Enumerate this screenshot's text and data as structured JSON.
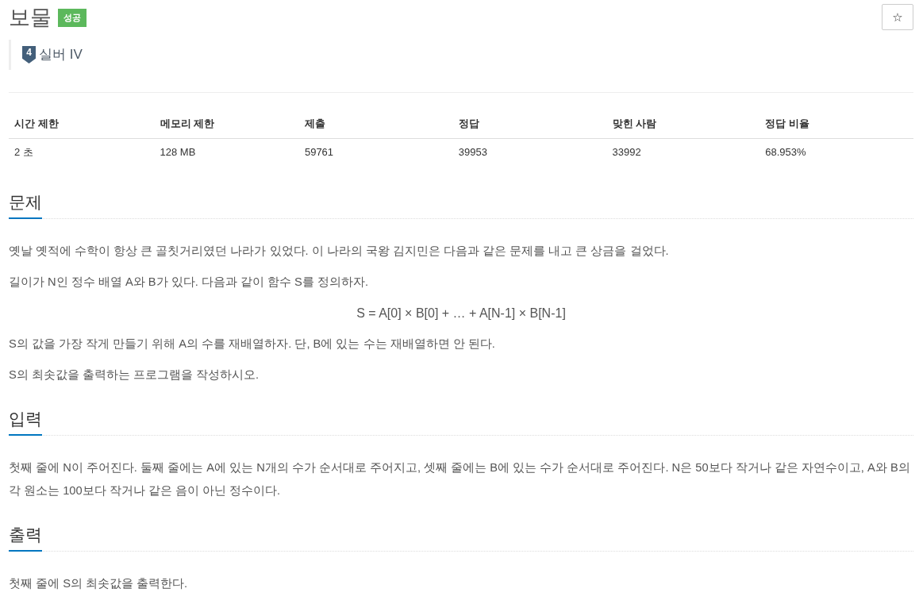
{
  "header": {
    "title": "보물",
    "status_badge": "성공",
    "tier": {
      "icon_number": "4",
      "name": "실버 IV"
    },
    "star_button": "☆"
  },
  "stats_table": {
    "columns": [
      "시간 제한",
      "메모리 제한",
      "제출",
      "정답",
      "맞힌 사람",
      "정답 비율"
    ],
    "rows": [
      [
        "2 초",
        "128 MB",
        "59761",
        "39953",
        "33992",
        "68.953%"
      ]
    ]
  },
  "sections": [
    {
      "heading": "문제",
      "blocks": [
        {
          "kind": "paragraph",
          "text": "옛날 옛적에 수학이 항상 큰 골칫거리였던 나라가 있었다. 이 나라의 국왕 김지민은 다음과 같은 문제를 내고 큰 상금을 걸었다."
        },
        {
          "kind": "paragraph",
          "text": "길이가 N인 정수 배열 A와 B가 있다. 다음과 같이 함수 S를 정의하자."
        },
        {
          "kind": "formula",
          "text": "S = A[0] × B[0] + … + A[N-1] × B[N-1]"
        },
        {
          "kind": "paragraph",
          "text": "S의 값을 가장 작게 만들기 위해 A의 수를 재배열하자. 단, B에 있는 수는 재배열하면 안 된다."
        },
        {
          "kind": "paragraph",
          "text": "S의 최솟값을 출력하는 프로그램을 작성하시오."
        }
      ]
    },
    {
      "heading": "입력",
      "blocks": [
        {
          "kind": "paragraph",
          "text": "첫째 줄에 N이 주어진다. 둘째 줄에는 A에 있는 N개의 수가 순서대로 주어지고, 셋째 줄에는 B에 있는 수가 순서대로 주어진다. N은 50보다 작거나 같은 자연수이고, A와 B의 각 원소는 100보다 작거나 같은 음이 아닌 정수이다."
        }
      ]
    },
    {
      "heading": "출력",
      "blocks": [
        {
          "kind": "paragraph",
          "text": "첫째 줄에 S의 최솟값을 출력한다."
        }
      ]
    }
  ]
}
